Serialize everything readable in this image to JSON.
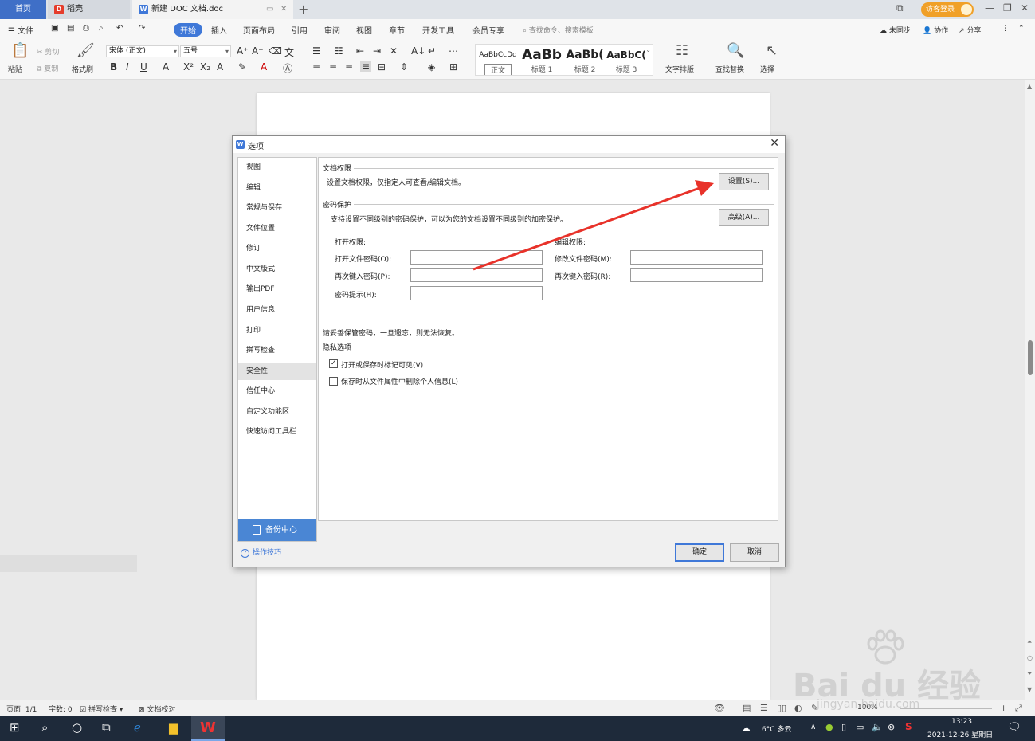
{
  "tabs": {
    "home": "首页",
    "docer": "稻壳",
    "doc": "新建 DOC 文档.doc",
    "login": "访客登录"
  },
  "menubar": {
    "file": "文件",
    "items": [
      "开始",
      "插入",
      "页面布局",
      "引用",
      "审阅",
      "视图",
      "章节",
      "开发工具",
      "会员专享"
    ],
    "search": "查找命令、搜索模板",
    "right": [
      "未同步",
      "协作",
      "分享"
    ]
  },
  "ribbon": {
    "paste": "粘贴",
    "cut": "剪切",
    "copy": "复制",
    "format_painter": "格式刷",
    "font_name": "宋体 (正文)",
    "font_size": "五号",
    "styles": [
      {
        "preview": "AaBbCcDd",
        "name": "正文"
      },
      {
        "preview": "AaBb",
        "name": "标题 1"
      },
      {
        "preview": "AaBb(",
        "name": "标题 2"
      },
      {
        "preview": "AaBbC(",
        "name": "标题 3"
      }
    ],
    "text_layout": "文字排版",
    "find_replace": "查找替换",
    "select": "选择"
  },
  "dialog": {
    "title": "选项",
    "nav": [
      "视图",
      "编辑",
      "常规与保存",
      "文件位置",
      "修订",
      "中文版式",
      "输出PDF",
      "用户信息",
      "打印",
      "拼写检查",
      "安全性",
      "信任中心",
      "自定义功能区",
      "快速访问工具栏"
    ],
    "active_nav": "安全性",
    "backup": "备份中心",
    "tips": "操作技巧",
    "doc_perm": {
      "title": "文档权限",
      "desc": "设置文档权限，仅指定人可查看/编辑文档。",
      "button": "设置(S)..."
    },
    "pwd": {
      "title": "密码保护",
      "desc": "支持设置不同级别的密码保护，可以为您的文档设置不同级别的加密保护。",
      "advanced": "高级(A)...",
      "open_perm": "打开权限:",
      "edit_perm": "编辑权限:",
      "open_pwd": "打开文件密码(O):",
      "open_again": "再次键入密码(P):",
      "hint": "密码提示(H):",
      "edit_pwd": "修改文件密码(M):",
      "edit_again": "再次键入密码(R):",
      "warning": "请妥善保管密码，一旦遗忘，则无法恢复。"
    },
    "privacy": {
      "title": "隐私选项",
      "opt1": "打开或保存时标记可见(V)",
      "opt1_checked": true,
      "opt2": "保存时从文件属性中删除个人信息(L)",
      "opt2_checked": false
    },
    "ok": "确定",
    "cancel": "取消"
  },
  "statusbar": {
    "page": "页面: 1/1",
    "words": "字数: 0",
    "spell": "拼写检查",
    "proof": "文档校对",
    "zoom": "100%"
  },
  "taskbar": {
    "weather": "6°C 多云",
    "time": "13:23",
    "date": "2021-12-26 星期日"
  },
  "watermark": {
    "text": "Bai du 经验",
    "sub": "jingyan.baidu.com"
  },
  "colors": {
    "accent": "#3f78d8",
    "annotation": "#e8322a",
    "login": "#f0a028"
  }
}
